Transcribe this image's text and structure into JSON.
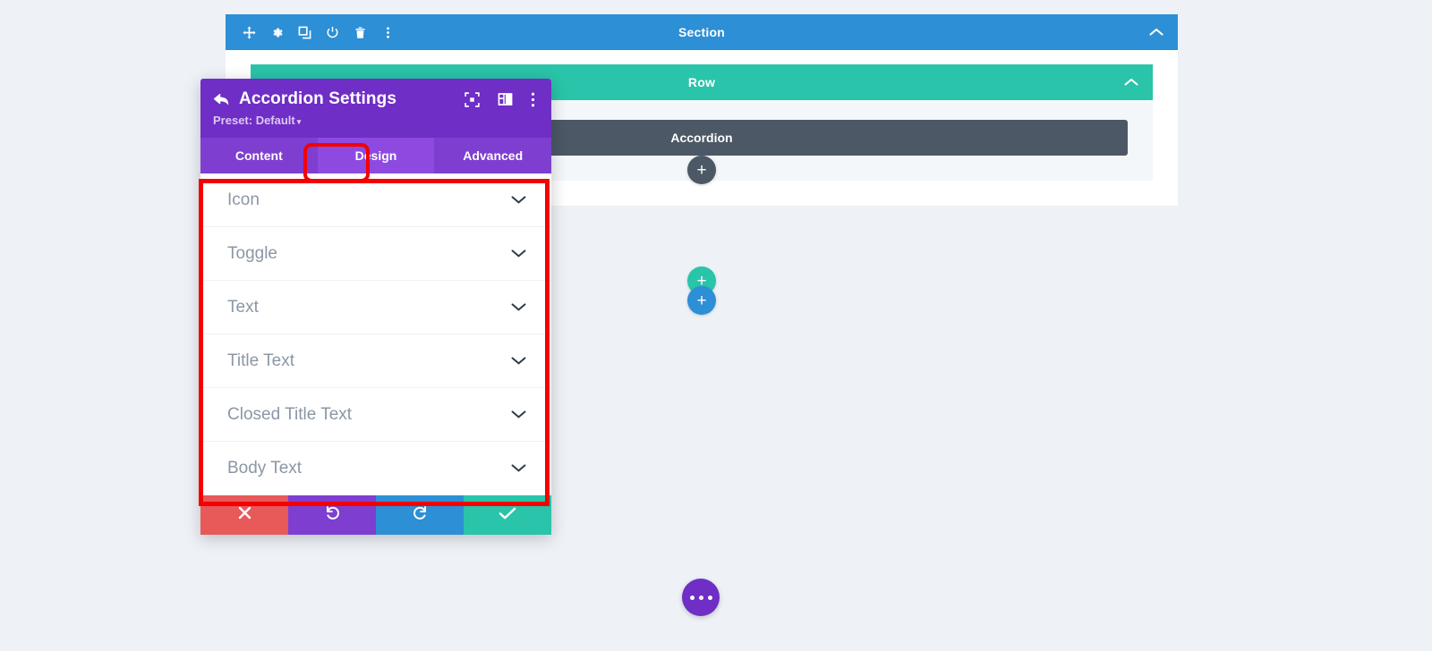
{
  "canvas": {
    "section": {
      "label": "Section",
      "color": "#2d8fd5",
      "tools": [
        {
          "name": "move-icon",
          "title": "Move"
        },
        {
          "name": "gear-icon",
          "title": "Settings"
        },
        {
          "name": "duplicate-icon",
          "title": "Duplicate"
        },
        {
          "name": "power-icon",
          "title": "Disable"
        },
        {
          "name": "trash-icon",
          "title": "Delete"
        },
        {
          "name": "more-vertical-icon",
          "title": "More"
        }
      ],
      "collapse_icon": "chevron-up-icon"
    },
    "row": {
      "label": "Row",
      "color": "#29c4a9",
      "collapse_icon": "chevron-up-icon"
    },
    "module": {
      "label": "Accordion",
      "color": "#4c5866"
    },
    "add_buttons": [
      {
        "name": "add-module-button",
        "glyph": "+",
        "color": "#4c5866"
      },
      {
        "name": "add-row-button",
        "glyph": "+",
        "color": "#29c4a9"
      },
      {
        "name": "add-section-button",
        "glyph": "+",
        "color": "#2d8fd5"
      }
    ],
    "fab": {
      "name": "builder-menu-button",
      "color": "#6f2ec6"
    },
    "background": "#eef2f7"
  },
  "settings": {
    "title": "Accordion Settings",
    "back_icon": "back-arrow-icon",
    "preset_label": "Preset: Default",
    "preset_caret": "▾",
    "header_color": "#6f2ec6",
    "header_icons": [
      {
        "name": "fullscreen-icon",
        "title": "Expand"
      },
      {
        "name": "layout-panel-icon",
        "title": "Panel layout"
      },
      {
        "name": "more-vertical-icon",
        "title": "More options"
      }
    ],
    "tabs": [
      {
        "label": "Content",
        "active": false
      },
      {
        "label": "Design",
        "active": true
      },
      {
        "label": "Advanced",
        "active": false
      }
    ],
    "sections": [
      {
        "label": "Icon",
        "chevron": "chevron-down-icon"
      },
      {
        "label": "Toggle",
        "chevron": "chevron-down-icon"
      },
      {
        "label": "Text",
        "chevron": "chevron-down-icon"
      },
      {
        "label": "Title Text",
        "chevron": "chevron-down-icon"
      },
      {
        "label": "Closed Title Text",
        "chevron": "chevron-down-icon"
      },
      {
        "label": "Body Text",
        "chevron": "chevron-down-icon"
      }
    ],
    "footer": [
      {
        "name": "cancel-button",
        "icon": "close-icon",
        "color": "#e8595a"
      },
      {
        "name": "undo-button",
        "icon": "undo-icon",
        "color": "#7e3fd1"
      },
      {
        "name": "redo-button",
        "icon": "redo-icon",
        "color": "#2d8fd5"
      },
      {
        "name": "save-button",
        "icon": "check-icon",
        "color": "#29c4a9"
      }
    ]
  },
  "highlights": {
    "accent_color": "#f40000",
    "design_tab": "Design",
    "design_panel": "Design section list"
  }
}
